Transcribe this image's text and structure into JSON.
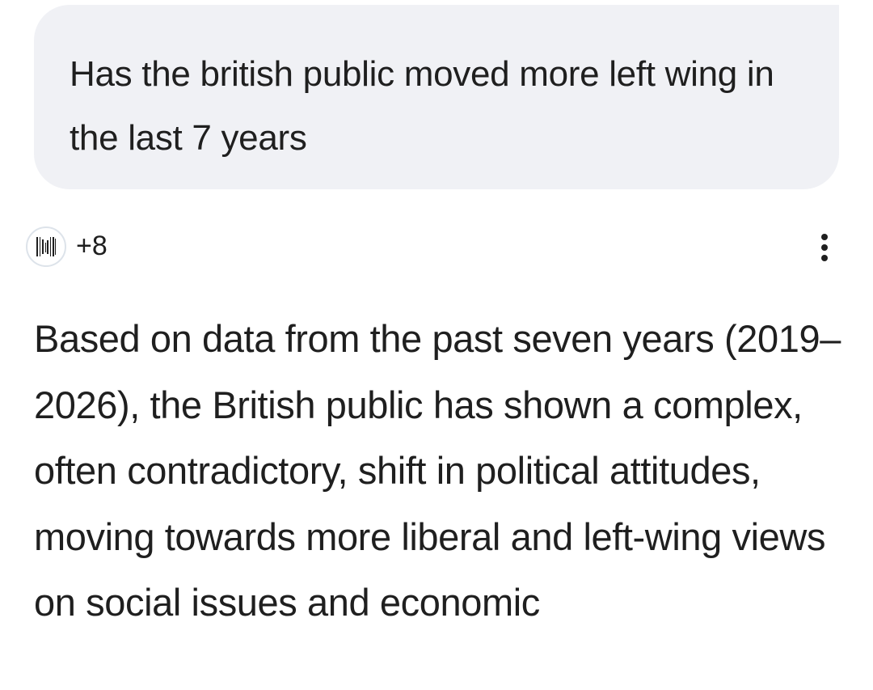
{
  "user_message": {
    "text": "Has the british public moved more left wing in the last 7 years"
  },
  "response_meta": {
    "source_icon": "barcode-icon",
    "source_count": "+8",
    "more_icon": "more-vert-icon"
  },
  "response": {
    "text": "Based on data from the past seven years (2019–2026), the British public has shown a complex, often contradictory, shift in political attitudes, moving towards more liberal and left-wing views on social issues and economic"
  },
  "colors": {
    "bubble_bg": "#f0f1f5",
    "text": "#1f1f1f",
    "icon_border": "#dde3ea"
  }
}
